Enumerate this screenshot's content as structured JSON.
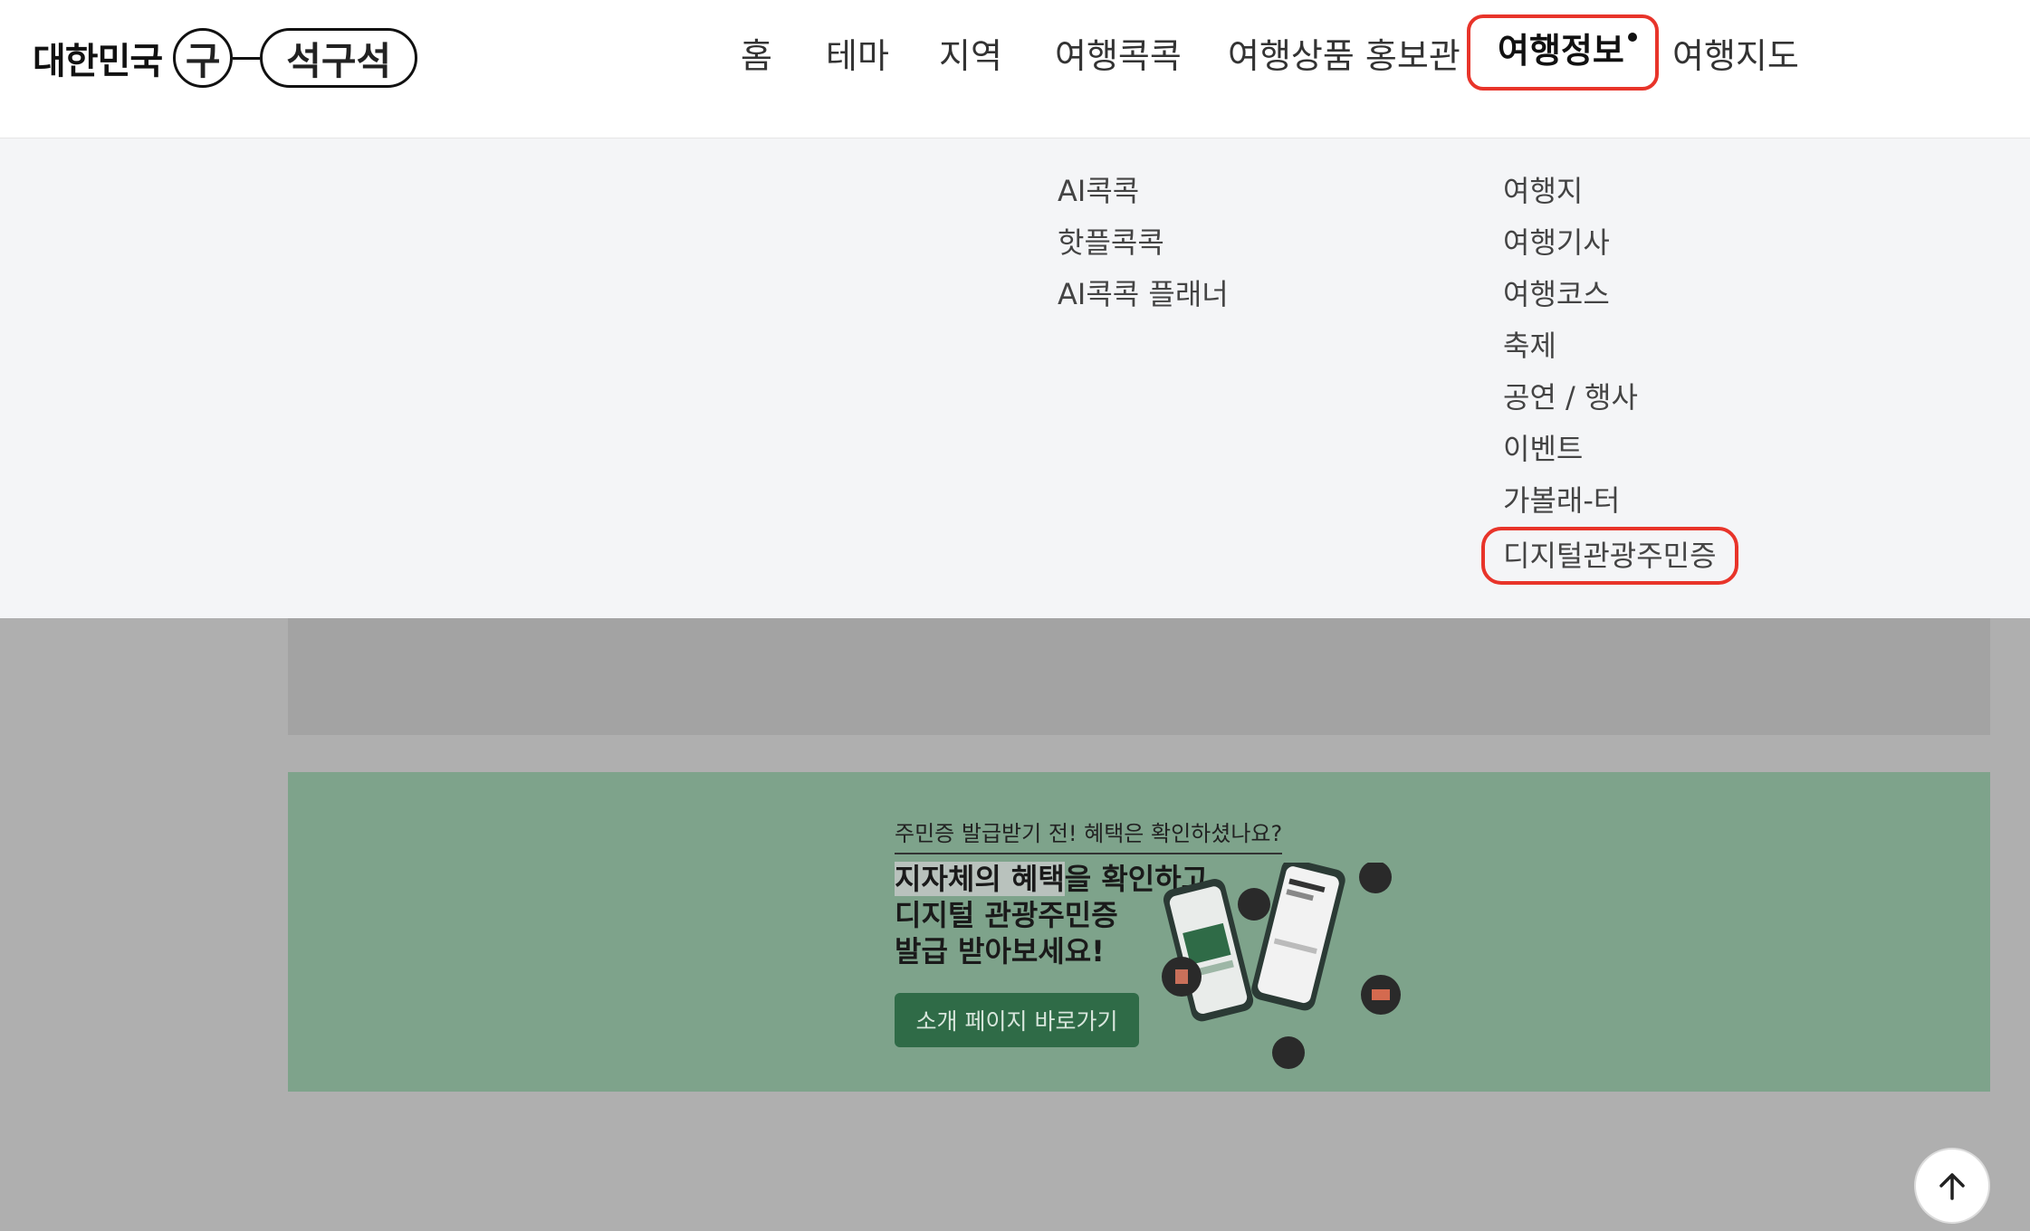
{
  "logo": {
    "text": "대한민국",
    "circle": "구",
    "pill": "석구석"
  },
  "nav": {
    "items": [
      "홈",
      "테마",
      "지역",
      "여행콕콕",
      "여행상품 홍보관",
      "여행정보",
      "여행지도"
    ],
    "active": "여행정보"
  },
  "dropdown": {
    "col1": [
      "AI콕콕",
      "핫플콕콕",
      "AI콕콕 플래너"
    ],
    "col2": [
      "여행지",
      "여행기사",
      "여행코스",
      "축제",
      "공연 / 행사",
      "이벤트",
      "가볼래-터",
      "디지털관광주민증"
    ]
  },
  "banner": {
    "subtitle": "주민증 발급받기 전! 혜택은 확인하셨나요?",
    "title_hl": "지자체의 혜택",
    "title_rest1": "을 확인하고,",
    "title_line2": "디지털 관광주민증",
    "title_line3": "발급 받아보세요!",
    "button": "소개 페이지 바로가기"
  },
  "colors": {
    "accent_outline": "#e8342a",
    "banner_bg": "#7ea38b",
    "button_bg": "#2f6b47"
  },
  "icons": {
    "scroll_top": "arrow-up-icon"
  }
}
